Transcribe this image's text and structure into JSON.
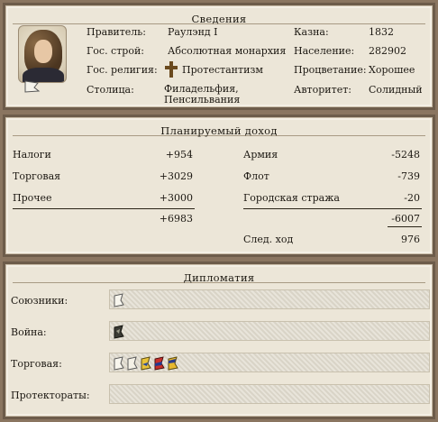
{
  "info": {
    "title": "Сведения",
    "ruler_label": "Правитель:",
    "ruler_value": "Раулэнд I",
    "government_label": "Гос. строй:",
    "government_value": "Абсолютная монархия",
    "religion_label": "Гос. религия:",
    "religion_value": "Протестантизм",
    "capital_label": "Столица:",
    "capital_value_line1": "Филадельфия,",
    "capital_value_line2": "Пенсильвания",
    "treasury_label": "Казна:",
    "treasury_value": "1832",
    "population_label": "Население:",
    "population_value": "282902",
    "prosperity_label": "Процветание:",
    "prosperity_value": "Хорошее",
    "authority_label": "Авторитет:",
    "authority_value": "Солидный"
  },
  "income": {
    "title": "Планируемый доход",
    "rows": [
      {
        "label": "Налоги",
        "value": "+954",
        "exp_label": "Армия",
        "exp_value": "-5248"
      },
      {
        "label": "Торговая",
        "value": "+3029",
        "exp_label": "Флот",
        "exp_value": "-739"
      },
      {
        "label": "Прочее",
        "value": "+3000",
        "exp_label": "Городская стража",
        "exp_value": "-20"
      }
    ],
    "income_total": "+6983",
    "expense_total": "-6007",
    "next_turn_label": "След. ход",
    "next_turn_value": "976"
  },
  "diplomacy": {
    "title": "Дипломатия",
    "allies_label": "Союзники:",
    "war_label": "Война:",
    "trade_label": "Торговая:",
    "protectorates_label": "Протектораты:",
    "allies_flags": [
      "white-flag-icon"
    ],
    "war_flags": [
      "dark-flag-icon"
    ],
    "trade_flags": [
      "white-flag-icon",
      "white-flag-icon",
      "yellow-flag-icon",
      "red-blue-flag-icon",
      "yellow-blue-flag-icon"
    ],
    "protectorate_flags": []
  }
}
